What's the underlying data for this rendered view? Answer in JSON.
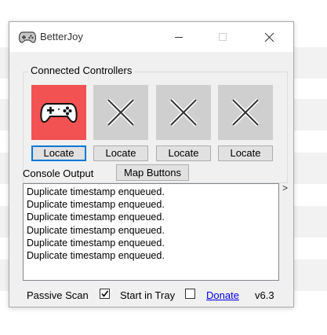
{
  "window": {
    "title": "BetterJoy"
  },
  "controllers": {
    "group_label": "Connected Controllers",
    "slots": [
      {
        "state": "connected",
        "icon": "gamepad-icon",
        "locate_label": "Locate"
      },
      {
        "state": "empty",
        "icon": "x-icon",
        "locate_label": "Locate"
      },
      {
        "state": "empty",
        "icon": "x-icon",
        "locate_label": "Locate"
      },
      {
        "state": "empty",
        "icon": "x-icon",
        "locate_label": "Locate"
      }
    ]
  },
  "console": {
    "label": "Console Output",
    "map_buttons_label": "Map Buttons",
    "expand_glyph": ">",
    "lines": [
      "Duplicate timestamp enqueued.",
      "Duplicate timestamp enqueued.",
      "Duplicate timestamp enqueued.",
      "Duplicate timestamp enqueued.",
      "Duplicate timestamp enqueued.",
      "Duplicate timestamp enqueued."
    ]
  },
  "footer": {
    "passive_scan_label": "Passive Scan",
    "passive_scan_checked": true,
    "start_in_tray_label": "Start in Tray",
    "start_in_tray_checked": false,
    "donate_label": "Donate",
    "version": "v6.3"
  },
  "colors": {
    "active_tile": "#f25252",
    "empty_tile": "#cfcfcf",
    "focus_border": "#0078d7",
    "link": "#0000ee"
  }
}
